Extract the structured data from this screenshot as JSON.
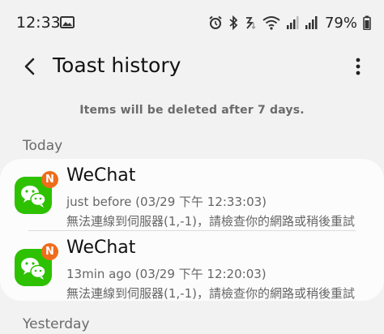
{
  "status_bar": {
    "time": "12:33",
    "battery_percent": "79%",
    "icons": [
      "photo-icon",
      "alarm-icon",
      "bluetooth-icon",
      "data-saver-icon",
      "wifi-icon",
      "signal-icon",
      "signal-icon",
      "battery-icon"
    ]
  },
  "app_bar": {
    "title": "Toast history",
    "back_icon": "back-arrow-icon",
    "more_icon": "more-vert-icon"
  },
  "notice": "Items will be deleted after 7 days.",
  "sections": {
    "today_label": "Today",
    "yesterday_label": "Yesterday"
  },
  "items": [
    {
      "app_name": "WeChat",
      "badge": "N",
      "time": "just before  (03/29 下午 12:33:03)",
      "message": "無法連線到伺服器(1,-1)，請檢查你的網路或稍後重試"
    },
    {
      "app_name": "WeChat",
      "badge": "N",
      "time": "13min ago  (03/29 下午 12:20:03)",
      "message": "無法連線到伺服器(1,-1)，請檢查你的網路或稍後重試"
    }
  ],
  "colors": {
    "background": "#f2f2f2",
    "card": "#fcfcfc",
    "wechat_green": "#2dc100",
    "badge_orange": "#ef6c1a",
    "secondary_text": "#666666"
  }
}
